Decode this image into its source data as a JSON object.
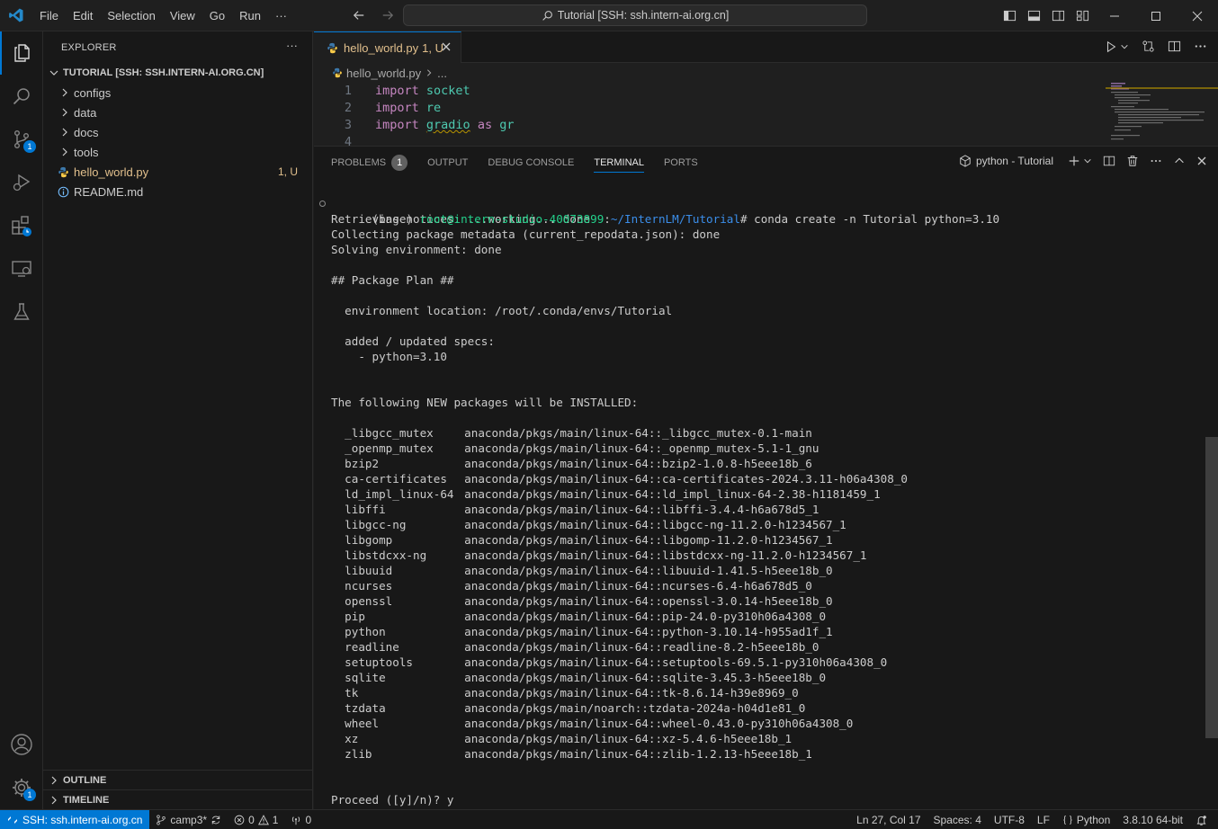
{
  "menu": [
    "File",
    "Edit",
    "Selection",
    "View",
    "Go",
    "Run",
    "···"
  ],
  "command_center": "Tutorial [SSH: ssh.intern-ai.org.cn]",
  "explorer": {
    "title": "EXPLORER",
    "more": "···",
    "root": "TUTORIAL [SSH: SSH.INTERN-AI.ORG.CN]",
    "items": [
      {
        "label": "configs",
        "type": "folder"
      },
      {
        "label": "data",
        "type": "folder"
      },
      {
        "label": "docs",
        "type": "folder"
      },
      {
        "label": "tools",
        "type": "folder"
      },
      {
        "label": "hello_world.py",
        "type": "python",
        "decoration": "1, U"
      },
      {
        "label": "README.md",
        "type": "info"
      }
    ],
    "outline": "OUTLINE",
    "timeline": "TIMELINE"
  },
  "activity_badges": {
    "scm": "1",
    "settings": "1"
  },
  "editor": {
    "tab_label": "hello_world.py",
    "tab_decoration": "1, U",
    "breadcrumb_file": "hello_world.py",
    "breadcrumb_more": "...",
    "lines": [
      {
        "n": "1",
        "kw": "import",
        "mod": "socket",
        "rest": ""
      },
      {
        "n": "2",
        "kw": "import",
        "mod": "re",
        "rest": ""
      },
      {
        "n": "3",
        "kw": "import",
        "mod": "gradio",
        "as": "as",
        "alias": "gr"
      },
      {
        "n": "4",
        "kw": "",
        "mod": "",
        "rest": ""
      }
    ]
  },
  "panel": {
    "tabs": [
      "PROBLEMS",
      "OUTPUT",
      "DEBUG CONSOLE",
      "TERMINAL",
      "PORTS"
    ],
    "problems_count": "1",
    "active_tab": "TERMINAL",
    "terminal_name": "python - Tutorial"
  },
  "terminal": {
    "prompt_env": "(base) ",
    "prompt_user": "root@intern-studio-40073899",
    "prompt_sep": ":",
    "prompt_path": "~/InternLM/Tutorial",
    "command": "# conda create -n Tutorial python=3.10",
    "lines_before": [
      "Retrieving notices: ...working... done",
      "Collecting package metadata (current_repodata.json): done",
      "Solving environment: done",
      "",
      "## Package Plan ##",
      "",
      "  environment location: /root/.conda/envs/Tutorial",
      "",
      "  added / updated specs:",
      "    - python=3.10",
      "",
      "",
      "The following NEW packages will be INSTALLED:",
      ""
    ],
    "packages": [
      {
        "name": "_libgcc_mutex",
        "src": "anaconda/pkgs/main/linux-64::_libgcc_mutex-0.1-main"
      },
      {
        "name": "_openmp_mutex",
        "src": "anaconda/pkgs/main/linux-64::_openmp_mutex-5.1-1_gnu"
      },
      {
        "name": "bzip2",
        "src": "anaconda/pkgs/main/linux-64::bzip2-1.0.8-h5eee18b_6"
      },
      {
        "name": "ca-certificates",
        "src": "anaconda/pkgs/main/linux-64::ca-certificates-2024.3.11-h06a4308_0"
      },
      {
        "name": "ld_impl_linux-64",
        "src": "anaconda/pkgs/main/linux-64::ld_impl_linux-64-2.38-h1181459_1"
      },
      {
        "name": "libffi",
        "src": "anaconda/pkgs/main/linux-64::libffi-3.4.4-h6a678d5_1"
      },
      {
        "name": "libgcc-ng",
        "src": "anaconda/pkgs/main/linux-64::libgcc-ng-11.2.0-h1234567_1"
      },
      {
        "name": "libgomp",
        "src": "anaconda/pkgs/main/linux-64::libgomp-11.2.0-h1234567_1"
      },
      {
        "name": "libstdcxx-ng",
        "src": "anaconda/pkgs/main/linux-64::libstdcxx-ng-11.2.0-h1234567_1"
      },
      {
        "name": "libuuid",
        "src": "anaconda/pkgs/main/linux-64::libuuid-1.41.5-h5eee18b_0"
      },
      {
        "name": "ncurses",
        "src": "anaconda/pkgs/main/linux-64::ncurses-6.4-h6a678d5_0"
      },
      {
        "name": "openssl",
        "src": "anaconda/pkgs/main/linux-64::openssl-3.0.14-h5eee18b_0"
      },
      {
        "name": "pip",
        "src": "anaconda/pkgs/main/linux-64::pip-24.0-py310h06a4308_0"
      },
      {
        "name": "python",
        "src": "anaconda/pkgs/main/linux-64::python-3.10.14-h955ad1f_1"
      },
      {
        "name": "readline",
        "src": "anaconda/pkgs/main/linux-64::readline-8.2-h5eee18b_0"
      },
      {
        "name": "setuptools",
        "src": "anaconda/pkgs/main/linux-64::setuptools-69.5.1-py310h06a4308_0"
      },
      {
        "name": "sqlite",
        "src": "anaconda/pkgs/main/linux-64::sqlite-3.45.3-h5eee18b_0"
      },
      {
        "name": "tk",
        "src": "anaconda/pkgs/main/linux-64::tk-8.6.14-h39e8969_0"
      },
      {
        "name": "tzdata",
        "src": "anaconda/pkgs/main/noarch::tzdata-2024a-h04d1e81_0"
      },
      {
        "name": "wheel",
        "src": "anaconda/pkgs/main/linux-64::wheel-0.43.0-py310h06a4308_0"
      },
      {
        "name": "xz",
        "src": "anaconda/pkgs/main/linux-64::xz-5.4.6-h5eee18b_1"
      },
      {
        "name": "zlib",
        "src": "anaconda/pkgs/main/linux-64::zlib-1.2.13-h5eee18b_1"
      }
    ],
    "proceed": "Proceed ([y]/n)? y"
  },
  "statusbar": {
    "remote": "SSH: ssh.intern-ai.org.cn",
    "branch": "camp3*",
    "errors": "0",
    "warnings": "1",
    "ports": "0",
    "position": "Ln 27, Col 17",
    "spaces": "Spaces: 4",
    "encoding": "UTF-8",
    "eol": "LF",
    "language": "Python",
    "interpreter": "3.8.10 64-bit"
  },
  "colors": {
    "accent": "#0078d4",
    "modified": "#e2c08d",
    "prompt_green": "#23d18b",
    "prompt_blue": "#3b8eea"
  }
}
